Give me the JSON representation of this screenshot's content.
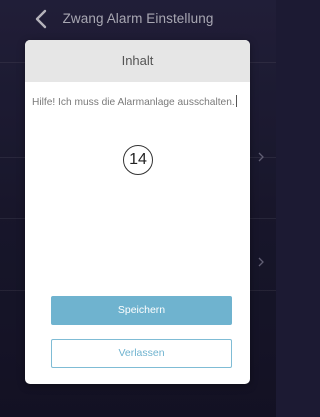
{
  "header": {
    "title": "Zwang Alarm Einstellung",
    "back_icon": "chevron-left-icon"
  },
  "dialog": {
    "title": "Inhalt",
    "message_value": "Hilfe! Ich muss die Alarmanlage ausschalten.",
    "annotation_badge": "14",
    "save_label": "Speichern",
    "leave_label": "Verlassen"
  },
  "colors": {
    "app_background": "#1e1c36",
    "dialog_header": "#e6e6e6",
    "accent": "#6fb3cf"
  }
}
